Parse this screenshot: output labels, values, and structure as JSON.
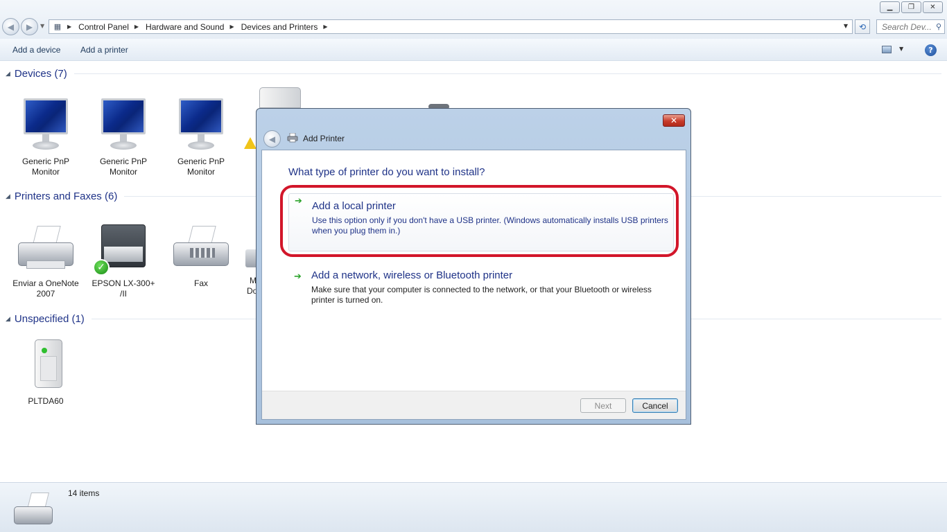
{
  "window": {
    "controls": [
      "minimize",
      "restore",
      "close"
    ]
  },
  "address": {
    "breadcrumbs": [
      "Control Panel",
      "Hardware and Sound",
      "Devices and Printers"
    ]
  },
  "search": {
    "placeholder": "Search Dev..."
  },
  "toolbar": {
    "add_device": "Add a device",
    "add_printer": "Add a printer"
  },
  "groups": {
    "devices": {
      "title": "Devices (7)",
      "items": [
        {
          "label_line1": "Generic PnP",
          "label_line2": "Monitor",
          "icon": "monitor-icon"
        },
        {
          "label_line1": "Generic PnP",
          "label_line2": "Monitor",
          "icon": "monitor-icon"
        },
        {
          "label_line1": "Generic PnP",
          "label_line2": "Monitor",
          "icon": "monitor-icon"
        }
      ]
    },
    "printers": {
      "title": "Printers and Faxes (6)",
      "items": [
        {
          "label_line1": "Enviar a OneNote",
          "label_line2": "2007",
          "icon": "printer-icon"
        },
        {
          "label_line1": "EPSON LX-300+",
          "label_line2": "/II",
          "icon": "printer-default-icon"
        },
        {
          "label_line1": "Fax",
          "label_line2": "",
          "icon": "fax-icon"
        }
      ],
      "partial_label_line1": "M",
      "partial_label_line2": "Do"
    },
    "unspecified": {
      "title": "Unspecified (1)",
      "items": [
        {
          "label_line1": "PLTDA60",
          "label_line2": "",
          "icon": "server-icon"
        }
      ]
    }
  },
  "status": {
    "count": "14 items"
  },
  "dialog": {
    "title": "Add Printer",
    "heading": "What type of printer do you want to install?",
    "options": [
      {
        "title": "Add a local printer",
        "description": "Use this option only if you don't have a USB printer. (Windows automatically installs USB printers when you plug them in.)"
      },
      {
        "title": "Add a network, wireless or Bluetooth printer",
        "description": "Make sure that your computer is connected to the network, or that your Bluetooth or wireless printer is turned on."
      }
    ],
    "next_label": "Next",
    "cancel_label": "Cancel",
    "highlight_color": "#d2162a"
  }
}
